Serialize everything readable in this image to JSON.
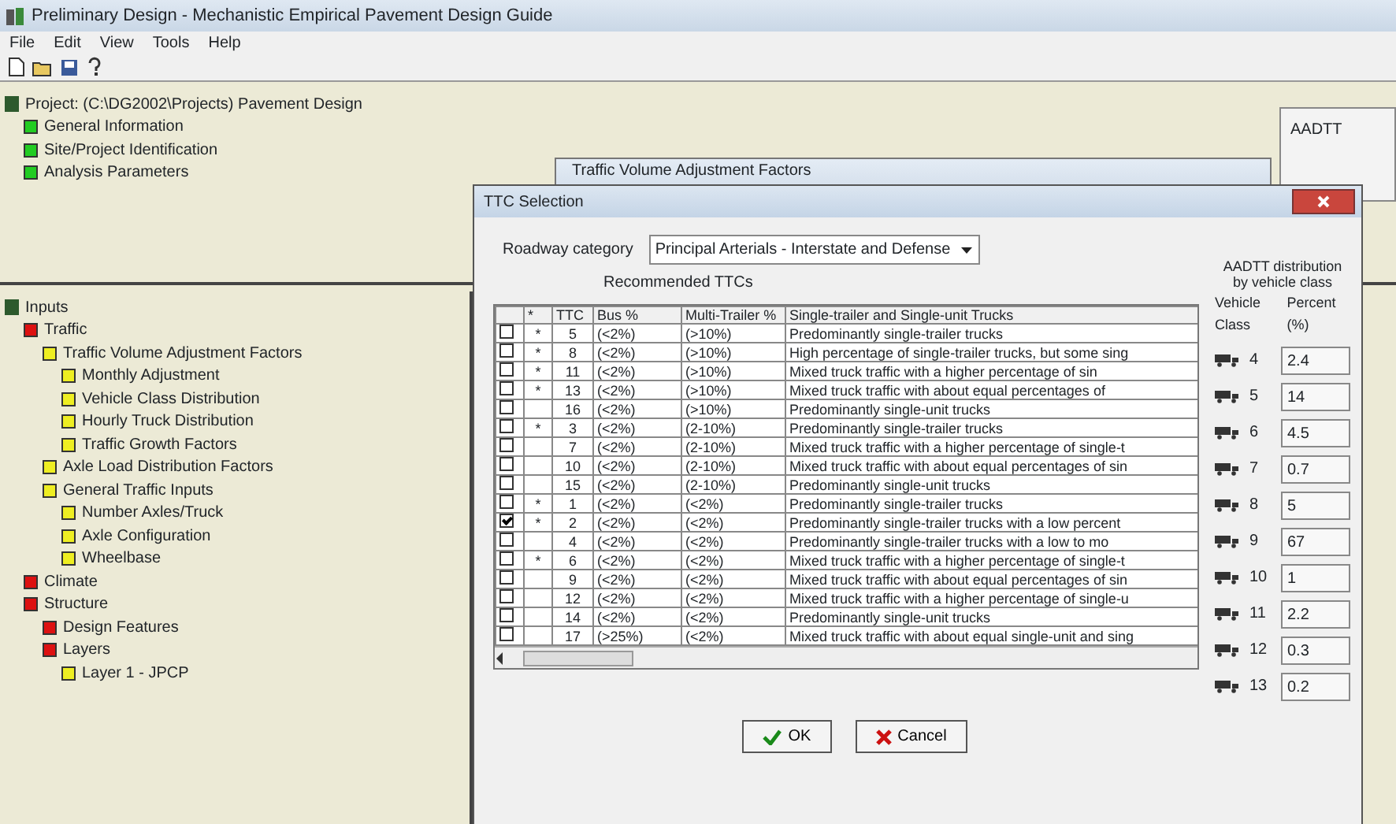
{
  "window": {
    "title": "Preliminary Design - Mechanistic Empirical Pavement Design Guide"
  },
  "menu": [
    "File",
    "Edit",
    "View",
    "Tools",
    "Help"
  ],
  "project_tree": {
    "label": "Project: (C:\\DG2002\\Projects) Pavement Design",
    "children": [
      {
        "label": "General Information",
        "color": "#22cc22"
      },
      {
        "label": "Site/Project Identification",
        "color": "#22cc22"
      },
      {
        "label": "Analysis Parameters",
        "color": "#22cc22"
      }
    ]
  },
  "inputs_tree": {
    "label": "Inputs",
    "children": [
      {
        "label": "Traffic",
        "color": "#dd1111",
        "children": [
          {
            "label": "Traffic Volume Adjustment Factors",
            "color": "#eeee22",
            "children": [
              {
                "label": "Monthly Adjustment",
                "color": "#eeee22"
              },
              {
                "label": "Vehicle Class Distribution",
                "color": "#eeee22"
              },
              {
                "label": "Hourly Truck Distribution",
                "color": "#eeee22"
              },
              {
                "label": "Traffic Growth Factors",
                "color": "#eeee22"
              }
            ]
          },
          {
            "label": "Axle Load Distribution Factors",
            "color": "#eeee22"
          },
          {
            "label": "General Traffic Inputs",
            "color": "#eeee22",
            "children": [
              {
                "label": "Number Axles/Truck",
                "color": "#eeee22"
              },
              {
                "label": "Axle Configuration",
                "color": "#eeee22"
              },
              {
                "label": "Wheelbase",
                "color": "#eeee22"
              }
            ]
          }
        ]
      },
      {
        "label": "Climate",
        "color": "#dd1111"
      },
      {
        "label": "Structure",
        "color": "#dd1111",
        "children": [
          {
            "label": "Design Features",
            "color": "#dd1111"
          },
          {
            "label": "Layers",
            "color": "#dd1111",
            "children": [
              {
                "label": "Layer 1 - JPCP",
                "color": "#eeee22"
              }
            ]
          }
        ]
      }
    ]
  },
  "back_window": {
    "title": "Traffic Volume Adjustment Factors"
  },
  "side_panel": {
    "label": "AADTT"
  },
  "dialog": {
    "title": "TTC Selection",
    "category_label": "Roadway category",
    "category_value": "Principal Arterials - Interstate and Defense",
    "filter_label": "Recommended TTCs",
    "columns": [
      "",
      "*",
      "TTC",
      "Bus %",
      "Multi-Trailer %",
      "Single-trailer and Single-unit Trucks"
    ],
    "rows": [
      {
        "checked": false,
        "mark": "*",
        "ttc": "5",
        "bus": "(<2%)",
        "multi": "(>10%)",
        "description": "Predominantly single-trailer trucks"
      },
      {
        "checked": false,
        "mark": "*",
        "ttc": "8",
        "bus": "(<2%)",
        "multi": "(>10%)",
        "description": "High percentage of single-trailer trucks, but some sing"
      },
      {
        "checked": false,
        "mark": "*",
        "ttc": "11",
        "bus": "(<2%)",
        "multi": "(>10%)",
        "description": "Mixed truck traffic with a higher percentage of sin"
      },
      {
        "checked": false,
        "mark": "*",
        "ttc": "13",
        "bus": "(<2%)",
        "multi": "(>10%)",
        "description": "Mixed truck traffic with about equal percentages of"
      },
      {
        "checked": false,
        "mark": "",
        "ttc": "16",
        "bus": "(<2%)",
        "multi": "(>10%)",
        "description": "Predominantly single-unit trucks"
      },
      {
        "checked": false,
        "mark": "*",
        "ttc": "3",
        "bus": "(<2%)",
        "multi": "(2-10%)",
        "description": "Predominantly single-trailer trucks"
      },
      {
        "checked": false,
        "mark": "",
        "ttc": "7",
        "bus": "(<2%)",
        "multi": "(2-10%)",
        "description": "Mixed truck traffic with a higher percentage of single-t"
      },
      {
        "checked": false,
        "mark": "",
        "ttc": "10",
        "bus": "(<2%)",
        "multi": "(2-10%)",
        "description": "Mixed truck traffic with about equal percentages of sin"
      },
      {
        "checked": false,
        "mark": "",
        "ttc": "15",
        "bus": "(<2%)",
        "multi": "(2-10%)",
        "description": "Predominantly single-unit trucks"
      },
      {
        "checked": false,
        "mark": "*",
        "ttc": "1",
        "bus": "(<2%)",
        "multi": "(<2%)",
        "description": "Predominantly single-trailer trucks"
      },
      {
        "checked": true,
        "mark": "*",
        "ttc": "2",
        "bus": "(<2%)",
        "multi": "(<2%)",
        "description": "Predominantly single-trailer trucks with a low percent"
      },
      {
        "checked": false,
        "mark": "",
        "ttc": "4",
        "bus": "(<2%)",
        "multi": "(<2%)",
        "description": "Predominantly single-trailer trucks with a low to mo"
      },
      {
        "checked": false,
        "mark": "*",
        "ttc": "6",
        "bus": "(<2%)",
        "multi": "(<2%)",
        "description": "Mixed truck traffic with a higher percentage of single-t"
      },
      {
        "checked": false,
        "mark": "",
        "ttc": "9",
        "bus": "(<2%)",
        "multi": "(<2%)",
        "description": "Mixed truck traffic with about equal percentages of sin"
      },
      {
        "checked": false,
        "mark": "",
        "ttc": "12",
        "bus": "(<2%)",
        "multi": "(<2%)",
        "description": "Mixed truck traffic with a higher percentage of single-u"
      },
      {
        "checked": false,
        "mark": "",
        "ttc": "14",
        "bus": "(<2%)",
        "multi": "(<2%)",
        "description": "Predominantly single-unit trucks"
      },
      {
        "checked": false,
        "mark": "",
        "ttc": "17",
        "bus": "(>25%)",
        "multi": "(<2%)",
        "description": "Mixed truck traffic with about equal single-unit and sing"
      }
    ],
    "distribution_title": "AADTT distribution by vehicle class",
    "distribution_headers": [
      "Vehicle Class",
      "Percent (%)"
    ],
    "classes": [
      {
        "label": "4",
        "value": "2.4"
      },
      {
        "label": "5",
        "value": "14"
      },
      {
        "label": "6",
        "value": "4.5"
      },
      {
        "label": "7",
        "value": "0.7"
      },
      {
        "label": "8",
        "value": "5"
      },
      {
        "label": "9",
        "value": "67"
      },
      {
        "label": "10",
        "value": "1"
      },
      {
        "label": "11",
        "value": "2.2"
      },
      {
        "label": "12",
        "value": "0.3"
      },
      {
        "label": "13",
        "value": "0.2"
      }
    ],
    "buttons": [
      {
        "kind": "ok",
        "label": "OK"
      },
      {
        "kind": "cancel",
        "label": "Cancel"
      }
    ]
  }
}
